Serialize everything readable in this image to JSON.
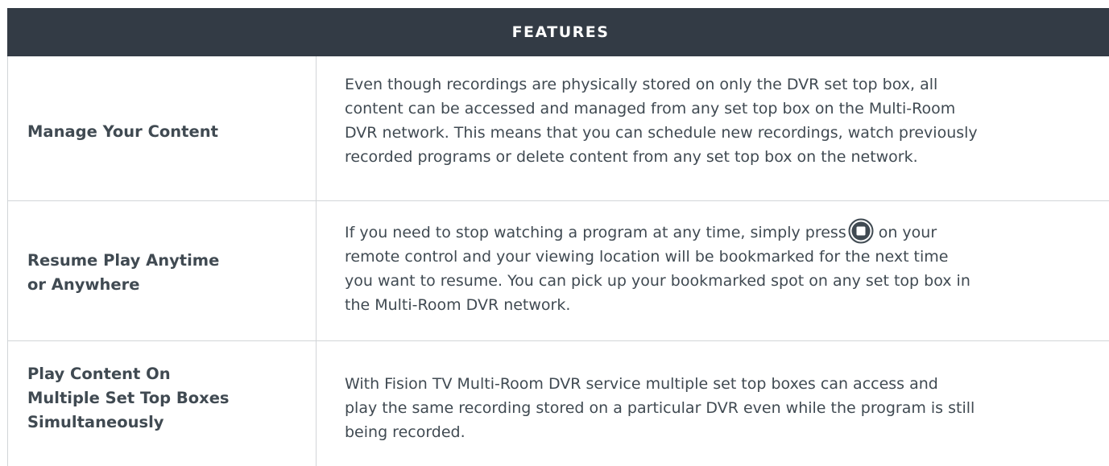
{
  "header": {
    "title": "FEATURES"
  },
  "features": [
    {
      "title_lines": [
        "Manage Your Content"
      ],
      "description_lines": [
        "Even though recordings are physically stored on only the DVR set top box, all",
        "content can be accessed and managed from any set top box on the Multi-Room",
        "DVR network. This means that you can schedule new recordings, watch previously",
        "recorded programs or delete content from any set top box on the network."
      ]
    },
    {
      "title_lines": [
        "Resume Play Anytime",
        "or Anywhere"
      ],
      "description_lines": [
        "If you need to stop watching a program at any time, simply press",
        "on your",
        "remote control and your viewing location will be bookmarked for the next time",
        "you want to resume. You can pick up your bookmarked spot on any set top box in",
        "the Multi-Room DVR network."
      ],
      "inline_icon": "stop-button-icon"
    },
    {
      "title_lines": [
        "Play Content On",
        "Multiple Set Top Boxes",
        "Simultaneously"
      ],
      "description_lines": [
        "With Fision TV Multi-Room DVR service multiple set top boxes can access and",
        "play the same recording stored on a particular DVR even while the program is still",
        "being recorded."
      ]
    }
  ],
  "colors": {
    "header_bg": "#333b45",
    "header_text": "#ffffff",
    "body_text": "#404a52",
    "border": "#d2d5d8"
  }
}
